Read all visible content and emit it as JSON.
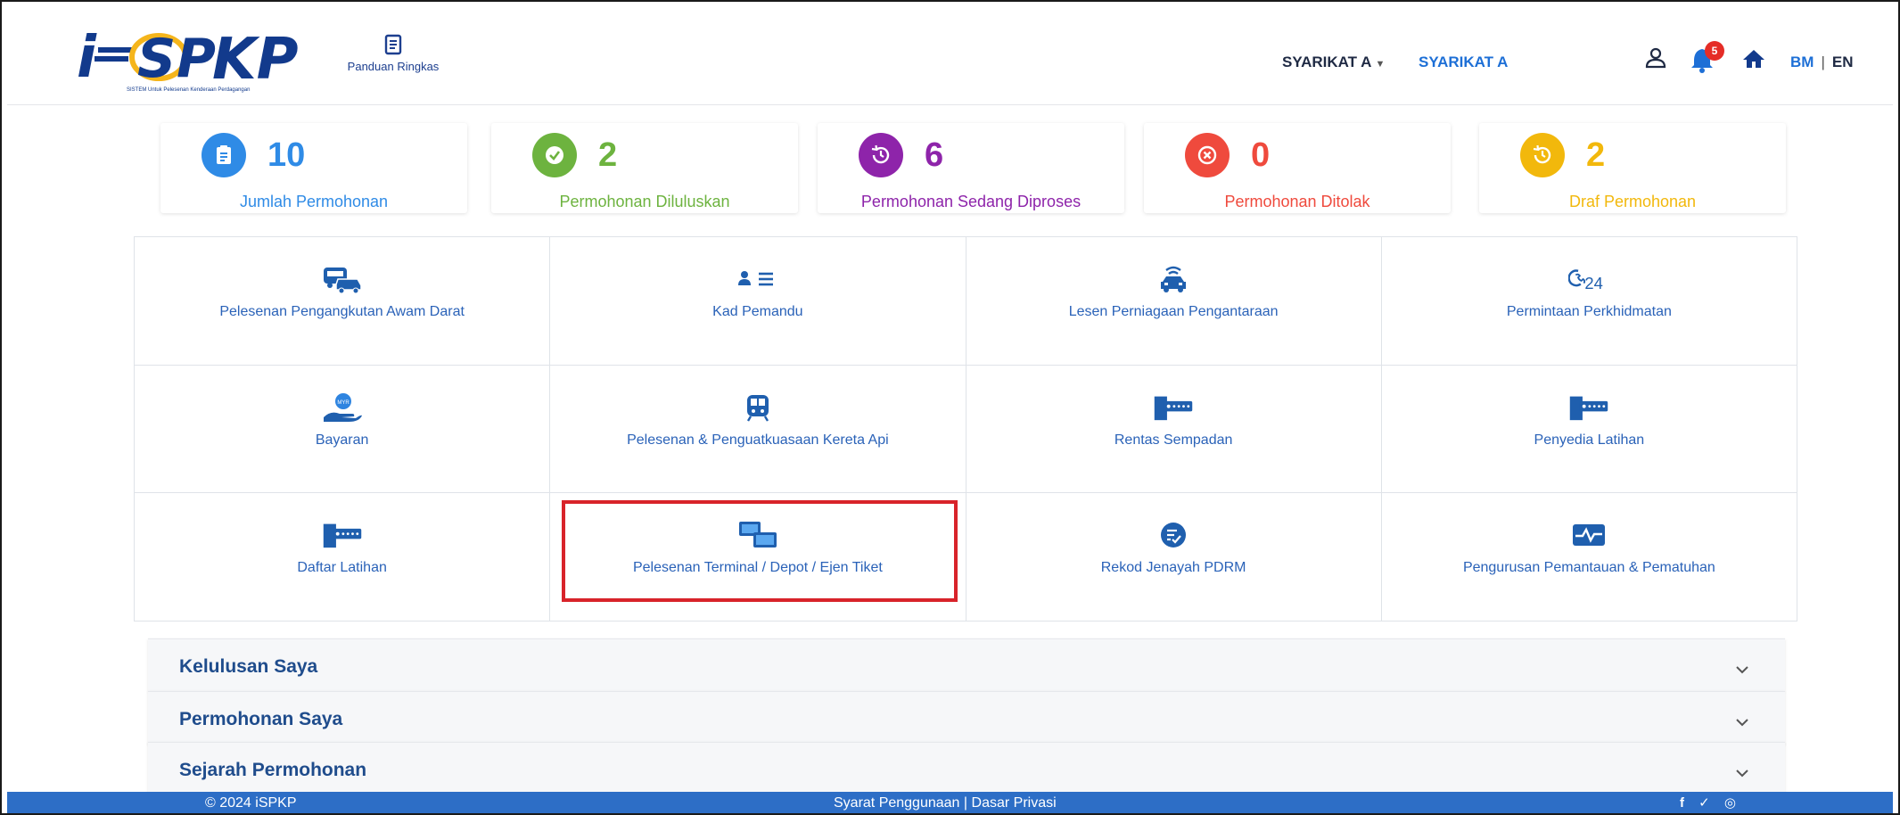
{
  "header": {
    "logo_text": "iSPKP",
    "logo_subtitle": "SISTEM Untuk Pelesenan Kenderaan Perdagangan",
    "panduan_label": "Panduan Ringkas",
    "company_dropdown": "SYARIKAT A",
    "company_name": "SYARIKAT A",
    "notification_count": "5",
    "lang_bm": "BM",
    "lang_separator": "|",
    "lang_en": "EN"
  },
  "stats": [
    {
      "value": "10",
      "label": "Jumlah Permohonan",
      "color": "#2f8be6",
      "icon": "clipboard-icon"
    },
    {
      "value": "2",
      "label": "Permohonan Diluluskan",
      "color": "#6db33f",
      "icon": "check-icon"
    },
    {
      "value": "6",
      "label": "Permohonan Sedang Diproses",
      "color": "#8e24aa",
      "icon": "history-icon"
    },
    {
      "value": "0",
      "label": "Permohonan Ditolak",
      "color": "#ef4a3d",
      "icon": "cancel-icon"
    },
    {
      "value": "2",
      "label": "Draf Permohonan",
      "color": "#f2b80c",
      "icon": "history-icon"
    }
  ],
  "services": [
    {
      "label": "Pelesenan Pengangkutan Awam Darat",
      "icon": "bus-car-icon"
    },
    {
      "label": "Kad Pemandu",
      "icon": "driver-card-icon"
    },
    {
      "label": "Lesen Perniagaan Pengantaraan",
      "icon": "connected-car-icon"
    },
    {
      "label": "Permintaan Perkhidmatan",
      "icon": "support-24-icon"
    },
    {
      "label": "Bayaran",
      "icon": "payment-hand-icon"
    },
    {
      "label": "Pelesenan & Penguatkuasaan Kereta Api",
      "icon": "train-icon"
    },
    {
      "label": "Rentas Sempadan",
      "icon": "door-password-icon"
    },
    {
      "label": "Penyedia Latihan",
      "icon": "door-password-icon"
    },
    {
      "label": "Daftar Latihan",
      "icon": "door-password-icon"
    },
    {
      "label": "Pelesenan Terminal / Depot / Ejen Tiket",
      "icon": "terminal-screens-icon"
    },
    {
      "label": "Rekod Jenayah PDRM",
      "icon": "record-check-icon"
    },
    {
      "label": "Pengurusan Pemantauan & Pematuhan",
      "icon": "monitor-pulse-icon"
    }
  ],
  "accordions": [
    {
      "title": "Kelulusan Saya"
    },
    {
      "title": "Permohonan Saya"
    },
    {
      "title": "Sejarah Permohonan"
    }
  ],
  "footer": {
    "copyright": "© 2024 iSPKP",
    "terms": "Syarat Penggunaan",
    "separator": "|",
    "privacy": "Dasar Privasi",
    "social": "f ✓ ◎"
  },
  "colors": {
    "primary": "#1d6fd6",
    "footer": "#2d6ec6",
    "icon_blue": "#1f5fae",
    "highlight": "#d8232a"
  }
}
